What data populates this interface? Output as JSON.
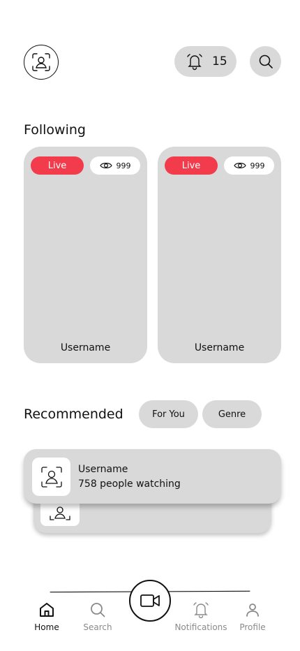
{
  "header": {
    "notification_count": "15"
  },
  "following": {
    "title": "Following",
    "cards": [
      {
        "badge": "Live",
        "viewers": "999",
        "username": "Username"
      },
      {
        "badge": "Live",
        "viewers": "999",
        "username": "Username"
      }
    ]
  },
  "recommended": {
    "title": "Recommended",
    "chips": [
      "For You",
      "Genre"
    ],
    "items": [
      {
        "username": "Username",
        "subtitle": "758 people watching"
      }
    ]
  },
  "bottom_nav": {
    "items": [
      {
        "label": "Home",
        "icon": "home-icon",
        "active": true
      },
      {
        "label": "Search",
        "icon": "search-icon",
        "active": false
      },
      {
        "label": "Notifications",
        "icon": "bell-icon",
        "active": false
      },
      {
        "label": "Profile",
        "icon": "person-icon",
        "active": false
      }
    ],
    "center_icon": "video-camera-icon"
  },
  "colors": {
    "live": "#f23b4b",
    "surface": "#d9d9d9",
    "inactive_nav": "#8a8a8a"
  }
}
